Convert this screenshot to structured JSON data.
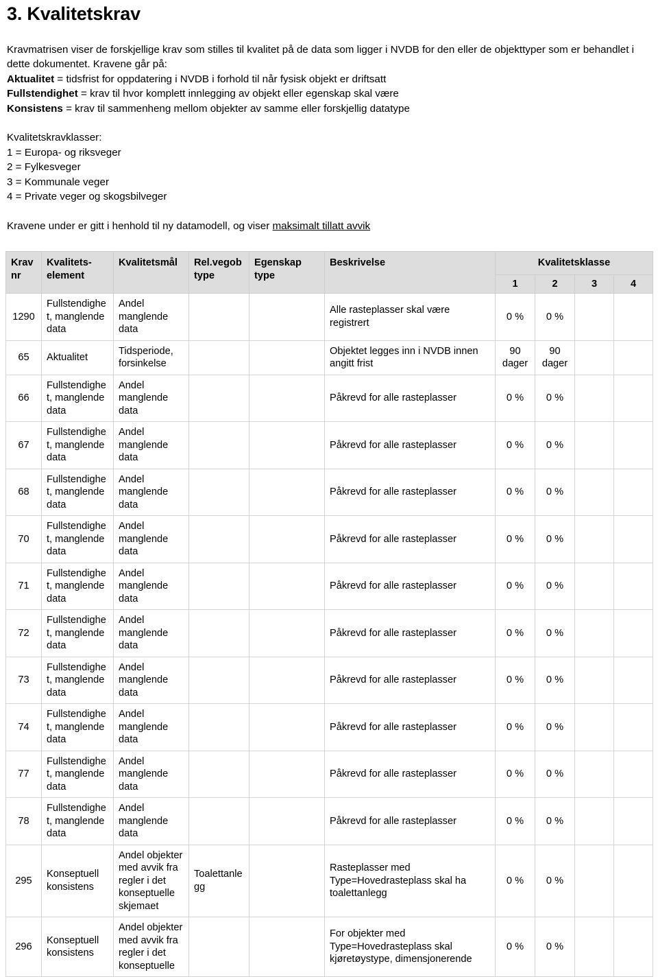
{
  "document": {
    "title": "3. Kvalitetskrav"
  },
  "intro": {
    "paragraph": "Kravmatrisen viser de forskjellige krav som stilles til kvalitet på de data som ligger i NVDB for den eller de objekttyper som er behandlet i dette dokumentet. Kravene går på:",
    "definitions": [
      {
        "term": "Aktualitet",
        "rest": " = tidsfrist for oppdatering i NVDB i forhold til når fysisk objekt er driftsatt"
      },
      {
        "term": "Fullstendighet",
        "rest": " = krav til hvor komplett innlegging av objekt eller egenskap skal være"
      },
      {
        "term": "Konsistens",
        "rest": " = krav til sammenheng mellom objekter av samme eller forskjellig datatype"
      }
    ],
    "klasser_heading": "Kvalitetskravklasser:",
    "klasser": [
      "1 = Europa- og riksveger",
      "2 = Fylkesveger",
      "3 = Kommunale veger",
      "4 = Private veger og skogsbilveger"
    ],
    "footnote_prefix": "Kravene under er gitt i henhold til ny datamodell, og viser ",
    "footnote_underlined": "maksimalt tillatt avvik"
  },
  "table": {
    "headers": {
      "krav_nr_line1": "Krav",
      "krav_nr_line2": "nr",
      "kvalitetselement_line1": "Kvalitets-",
      "kvalitetselement_line2": "element",
      "kvalitetsmaal": "Kvalitetsmål",
      "rel_vegob_line1": "Rel.vegob",
      "rel_vegob_line2": "type",
      "egenskap_line1": "Egenskap",
      "egenskap_line2": "type",
      "beskrivelse": "Beskrivelse",
      "kvalitetsklasse": "Kvalitetsklasse",
      "klasse_1": "1",
      "klasse_2": "2",
      "klasse_3": "3",
      "klasse_4": "4"
    },
    "rows": [
      {
        "krav_nr": "1290",
        "kvalitetselement": "Fullstendighet, manglende data",
        "kvalitetsmaal": "Andel manglende data",
        "rel_vegob_type": "",
        "egenskap_type": "",
        "beskrivelse": "Alle rasteplasser skal være registrert",
        "k1": "0 %",
        "k2": "0 %",
        "k3": "",
        "k4": ""
      },
      {
        "krav_nr": "65",
        "kvalitetselement": "Aktualitet",
        "kvalitetsmaal": "Tidsperiode, forsinkelse",
        "rel_vegob_type": "",
        "egenskap_type": "",
        "beskrivelse": "Objektet legges inn i NVDB innen angitt frist",
        "k1": "90 dager",
        "k2": "90 dager",
        "k3": "",
        "k4": ""
      },
      {
        "krav_nr": "66",
        "kvalitetselement": "Fullstendighet, manglende data",
        "kvalitetsmaal": "Andel manglende data",
        "rel_vegob_type": "",
        "egenskap_type": "",
        "beskrivelse": "Påkrevd for alle rasteplasser",
        "k1": "0 %",
        "k2": "0 %",
        "k3": "",
        "k4": ""
      },
      {
        "krav_nr": "67",
        "kvalitetselement": "Fullstendighet, manglende data",
        "kvalitetsmaal": "Andel manglende data",
        "rel_vegob_type": "",
        "egenskap_type": "",
        "beskrivelse": "Påkrevd for alle rasteplasser",
        "k1": "0 %",
        "k2": "0 %",
        "k3": "",
        "k4": ""
      },
      {
        "krav_nr": "68",
        "kvalitetselement": "Fullstendighet, manglende data",
        "kvalitetsmaal": "Andel manglende data",
        "rel_vegob_type": "",
        "egenskap_type": "",
        "beskrivelse": "Påkrevd for alle rasteplasser",
        "k1": "0 %",
        "k2": "0 %",
        "k3": "",
        "k4": ""
      },
      {
        "krav_nr": "70",
        "kvalitetselement": "Fullstendighet, manglende data",
        "kvalitetsmaal": "Andel manglende data",
        "rel_vegob_type": "",
        "egenskap_type": "",
        "beskrivelse": "Påkrevd for alle rasteplasser",
        "k1": "0 %",
        "k2": "0 %",
        "k3": "",
        "k4": ""
      },
      {
        "krav_nr": "71",
        "kvalitetselement": "Fullstendighet, manglende data",
        "kvalitetsmaal": "Andel manglende data",
        "rel_vegob_type": "",
        "egenskap_type": "",
        "beskrivelse": "Påkrevd for alle rasteplasser",
        "k1": "0 %",
        "k2": "0 %",
        "k3": "",
        "k4": ""
      },
      {
        "krav_nr": "72",
        "kvalitetselement": "Fullstendighet, manglende data",
        "kvalitetsmaal": "Andel manglende data",
        "rel_vegob_type": "",
        "egenskap_type": "",
        "beskrivelse": "Påkrevd for alle rasteplasser",
        "k1": "0 %",
        "k2": "0 %",
        "k3": "",
        "k4": ""
      },
      {
        "krav_nr": "73",
        "kvalitetselement": "Fullstendighet, manglende data",
        "kvalitetsmaal": "Andel manglende data",
        "rel_vegob_type": "",
        "egenskap_type": "",
        "beskrivelse": "Påkrevd for alle rasteplasser",
        "k1": "0 %",
        "k2": "0 %",
        "k3": "",
        "k4": ""
      },
      {
        "krav_nr": "74",
        "kvalitetselement": "Fullstendighet, manglende data",
        "kvalitetsmaal": "Andel manglende data",
        "rel_vegob_type": "",
        "egenskap_type": "",
        "beskrivelse": "Påkrevd for alle rasteplasser",
        "k1": "0 %",
        "k2": "0 %",
        "k3": "",
        "k4": ""
      },
      {
        "krav_nr": "77",
        "kvalitetselement": "Fullstendighet, manglende data",
        "kvalitetsmaal": "Andel manglende data",
        "rel_vegob_type": "",
        "egenskap_type": "",
        "beskrivelse": "Påkrevd for alle rasteplasser",
        "k1": "0 %",
        "k2": "0 %",
        "k3": "",
        "k4": ""
      },
      {
        "krav_nr": "78",
        "kvalitetselement": "Fullstendighet, manglende data",
        "kvalitetsmaal": "Andel manglende data",
        "rel_vegob_type": "",
        "egenskap_type": "",
        "beskrivelse": "Påkrevd for alle rasteplasser",
        "k1": "0 %",
        "k2": "0 %",
        "k3": "",
        "k4": ""
      },
      {
        "krav_nr": "295",
        "kvalitetselement": "Konseptuell konsistens",
        "kvalitetsmaal": "Andel objekter med avvik fra regler i det konseptuelle skjemaet",
        "rel_vegob_type": "Toalettanlegg",
        "egenskap_type": "",
        "beskrivelse": "Rasteplasser med Type=Hovedrasteplass skal ha toalettanlegg",
        "k1": "0 %",
        "k2": "0 %",
        "k3": "",
        "k4": ""
      },
      {
        "krav_nr": "296",
        "kvalitetselement": "Konseptuell konsistens",
        "kvalitetsmaal": "Andel objekter med avvik fra regler i det konseptuelle",
        "rel_vegob_type": "",
        "egenskap_type": "",
        "beskrivelse": "For objekter med Type=Hovedrasteplass skal kjøretøystype, dimensjonerende",
        "k1": "0 %",
        "k2": "0 %",
        "k3": "",
        "k4": ""
      }
    ]
  }
}
